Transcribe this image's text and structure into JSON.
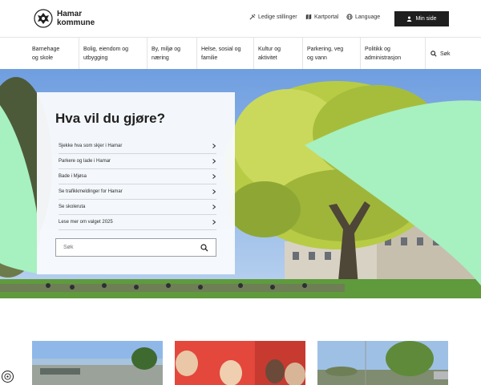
{
  "header": {
    "logo_line1": "Hamar",
    "logo_line2": "kommune",
    "links": [
      {
        "label": "Ledige stillinger",
        "icon": "tools-icon"
      },
      {
        "label": "Kartportal",
        "icon": "map-icon"
      },
      {
        "label": "Language",
        "icon": "globe-icon"
      }
    ],
    "login_label": "Min side"
  },
  "nav": {
    "items": [
      {
        "line1": "Barnehage",
        "line2": "og skole"
      },
      {
        "line1": "Bolig, eiendom og",
        "line2": "utbygging"
      },
      {
        "line1": "By, miljø og",
        "line2": "næring"
      },
      {
        "line1": "Helse, sosial og",
        "line2": "familie"
      },
      {
        "line1": "Kultur og",
        "line2": "aktivitet"
      },
      {
        "line1": "Parkering, veg",
        "line2": "og vann"
      },
      {
        "line1": "Politikk og",
        "line2": "administrasjon"
      }
    ],
    "search_label": "Søk"
  },
  "hero": {
    "title": "Hva vil du gjøre?",
    "tasks": [
      "Sjekke hva som skjer i Hamar",
      "Parkere og lade i Hamar",
      "Bade i Mjøsa",
      "Se trafikkmeldinger for Hamar",
      "Se skoleruta",
      "Lese mer om valget 2025"
    ],
    "search_placeholder": "Søk"
  },
  "colors": {
    "accent_green": "#a7f0c0",
    "dark": "#1f1f1f"
  }
}
